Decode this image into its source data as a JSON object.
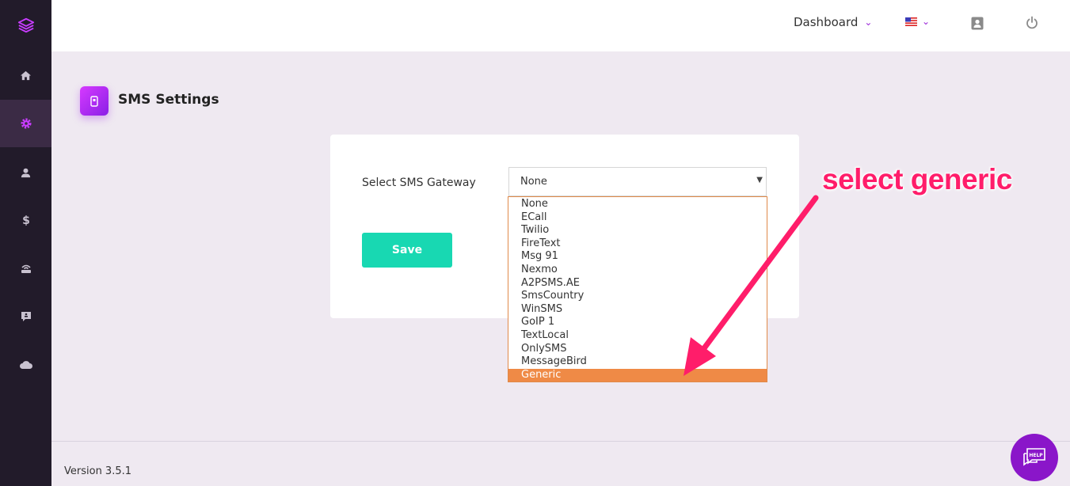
{
  "header": {
    "dashboard_label": "Dashboard",
    "icons": [
      "chevron-down-icon",
      "us-flag-icon",
      "profile-icon",
      "power-icon"
    ]
  },
  "sidebar": {
    "items": [
      {
        "icon": "layers-logo-icon"
      },
      {
        "icon": "home-icon"
      },
      {
        "icon": "gear-icon",
        "active": true
      },
      {
        "icon": "user-icon"
      },
      {
        "icon": "dollar-icon"
      },
      {
        "icon": "router-icon"
      },
      {
        "icon": "message-icon"
      },
      {
        "icon": "cloud-icon"
      }
    ]
  },
  "page": {
    "title": "SMS Settings",
    "icon": "phone-icon"
  },
  "form": {
    "gateway_label": "Select SMS Gateway",
    "gateway_value": "None",
    "save_label": "Save"
  },
  "dropdown": {
    "options": [
      "None",
      "ECall",
      "Twilio",
      "FireText",
      "Msg 91",
      "Nexmo",
      "A2PSMS.AE",
      "SmsCountry",
      "WinSMS",
      "GoIP 1",
      "TextLocal",
      "OnlySMS",
      "MessageBird",
      "Generic"
    ],
    "highlighted": "Generic"
  },
  "annotation": {
    "text": "select generic"
  },
  "footer": {
    "version": "Version 3.5.1",
    "help_label": "HELP"
  },
  "colors": {
    "sidebar_bg": "#221b2a",
    "accent_purple": "#9b27d8",
    "save_button": "#18d8b2",
    "highlight_option": "#ef8a46",
    "annotation": "#ff1d6a"
  }
}
